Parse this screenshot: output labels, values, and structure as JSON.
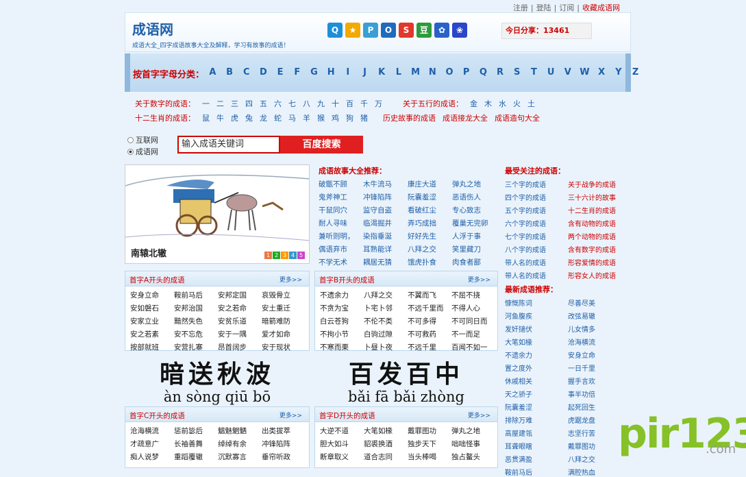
{
  "toplinks": {
    "register": "注册",
    "sep1": "|",
    "login": "登陆",
    "sep2": "|",
    "subscribe": "订阅",
    "sep3": "|",
    "favorite": "收藏成语网"
  },
  "header": {
    "title": "成语网",
    "subtitle": "成语大全_四字成语故事大全及解释，学习有故事的成语！",
    "share_label": "今日分享：",
    "share_count": "13461"
  },
  "share_icons": [
    {
      "name": "qq-icon",
      "color": "#1d8fd8",
      "glyph": "Q"
    },
    {
      "name": "qzone-icon",
      "color": "#f2a900",
      "glyph": "★"
    },
    {
      "name": "tencent-weibo-icon",
      "color": "#3a9fd6",
      "glyph": "P"
    },
    {
      "name": "renren-icon",
      "color": "#1f6bbd",
      "glyph": "O"
    },
    {
      "name": "sina-weibo-icon",
      "color": "#e0382c",
      "glyph": "S"
    },
    {
      "name": "douban-icon",
      "color": "#2d9b3b",
      "glyph": "豆"
    },
    {
      "name": "baidu-icon",
      "color": "#2a62c9",
      "glyph": "✿"
    },
    {
      "name": "baidu-paw-icon",
      "color": "#2a46c9",
      "glyph": "❀"
    }
  ],
  "alpha": {
    "label": "按首字字母分类：",
    "letters": [
      "A",
      "B",
      "C",
      "D",
      "E",
      "F",
      "G",
      "H",
      "I",
      "J",
      "K",
      "L",
      "M",
      "N",
      "O",
      "P",
      "Q",
      "R",
      "S",
      "T",
      "U",
      "V",
      "W",
      "X",
      "Y",
      "Z"
    ]
  },
  "row1": {
    "label": "关于数字的成语：",
    "items": [
      "一",
      "二",
      "三",
      "四",
      "五",
      "六",
      "七",
      "八",
      "九",
      "十",
      "百",
      "千",
      "万"
    ],
    "label2": "关于五行的成语：",
    "items2": [
      "金",
      "木",
      "水",
      "火",
      "土"
    ]
  },
  "row2": {
    "label": "十二生肖的成语：",
    "items": [
      "鼠",
      "牛",
      "虎",
      "兔",
      "龙",
      "蛇",
      "马",
      "羊",
      "猴",
      "鸡",
      "狗",
      "猪"
    ],
    "links": [
      "历史故事的成语",
      "成语接龙大全",
      "成语造句大全"
    ]
  },
  "search": {
    "option1": "互联网",
    "option2": "成语网",
    "placeholder": "输入成语关键词",
    "button": "百度搜索"
  },
  "picture": {
    "caption": "南辕北辙",
    "pages": [
      "1",
      "2",
      "3",
      "4",
      "5"
    ]
  },
  "recommend": {
    "title": "成语故事大全推荐：",
    "items": [
      "破甑不顾",
      "木牛流马",
      "康庄大道",
      "弹丸之地",
      "鬼斧神工",
      "冲锋陷阵",
      "阮囊羞涩",
      "恶语伤人",
      "干鼠同穴",
      "监守自盗",
      "看破红尘",
      "专心致志",
      "耐人寻味",
      "临渴掘井",
      "弄巧成拙",
      "覆巢无完卵",
      "兼听则明，",
      "染指垂涎",
      "好好先生",
      "人浮于事",
      "偶语弃市",
      "耳熟能详",
      "八拜之交",
      "笑里藏刀",
      "不学无术",
      "耦居无猜",
      "饿虎扑食",
      "肉食者鄙"
    ]
  },
  "care": {
    "title": "最受关注的成语：",
    "items": [
      "三个字的成语",
      "关于战争的成语",
      "四个字的成语",
      "三十六计的故事",
      "五个字的成语",
      "十二生肖的成语",
      "六个字的成语",
      "含有动物的成语",
      "七个字的成语",
      "两个动物的成语",
      "八个字的成语",
      "含有数字的成语",
      "带人名的成语",
      "形容爱情的成语",
      "带人名的成语",
      "形容女人的成语"
    ]
  },
  "newest": {
    "title": "最新成语推荐：",
    "items": [
      "慷慨陈词",
      "尽善尽美",
      "河鱼腹疾",
      "改弦易辙",
      "发奸擿伏",
      "儿女情多",
      "大笔如椽",
      "沧海横流",
      "不遗余力",
      "安身立命",
      "置之度外",
      "一日千里",
      "休戚相关",
      "握手言欢",
      "天之骄子",
      "事半功倍",
      "阮囊羞涩",
      "起死回生",
      "排除万难",
      "虎踞龙盘",
      "高屋建瓴",
      "志坚行苦",
      "耳聋眼瞎",
      "戴罪图功",
      "恶贯满盈",
      "八拜之交",
      "鞍前马后",
      "满腔热血"
    ]
  },
  "boxA": {
    "title": "首字A开头的成语",
    "more": "更多>>",
    "items": [
      "安身立命",
      "鞍前马后",
      "安邦定国",
      "哀毁骨立",
      "安如磐石",
      "安邦治国",
      "安之若命",
      "安土重迁",
      "安家立业",
      "黯然失色",
      "安贫乐道",
      "暗箭难防",
      "安之若素",
      "安不忘危",
      "安于一隅",
      "爱才如命",
      "按部就班",
      "安营扎寨",
      "昂首阔步",
      "安于现状"
    ]
  },
  "boxB": {
    "title": "首字B开头的成语",
    "more": "更多>>",
    "items": [
      "不遗余力",
      "八拜之交",
      "不翼而飞",
      "不屈不挠",
      "不贪为宝",
      "卜宅卜邻",
      "不远千里而",
      "不得人心",
      "白云苍狗",
      "不伦不类",
      "不可多得",
      "不可同日而",
      "不拘小节",
      "白驹过隙",
      "不可救药",
      "不一而足",
      "不寒而栗",
      "卜昼卜夜",
      "不远千里",
      "百闻不如一"
    ]
  },
  "bigA": {
    "hanzi": "暗送秋波",
    "pinyin": "àn sòng qiū bō"
  },
  "bigB": {
    "hanzi": "百发百中",
    "pinyin": "bǎi fā bǎi zhòng"
  },
  "boxC": {
    "title": "首字C开头的成语",
    "more": "更多>>",
    "items": [
      "沧海横流",
      "惩前毖后",
      "魑魅魍魉",
      "出类拔萃",
      "才疏意广",
      "长袖善舞",
      "绰绰有余",
      "冲锋陷阵",
      "痴人说梦",
      "重蹈覆辙",
      "沉默寡言",
      "垂帘听政"
    ]
  },
  "boxD": {
    "title": "首字D开头的成语",
    "more": "更多>>",
    "items": [
      "大逆不道",
      "大笔如椽",
      "戴罪图功",
      "弹丸之地",
      "胆大如斗",
      "貂裘换酒",
      "独步天下",
      "咄咄怪事",
      "断章取义",
      "道合志同",
      "当头棒喝",
      "独占鳌头"
    ]
  },
  "watermark": {
    "text": "pir123",
    ".com": ".com",
    "suffix": ".com"
  }
}
